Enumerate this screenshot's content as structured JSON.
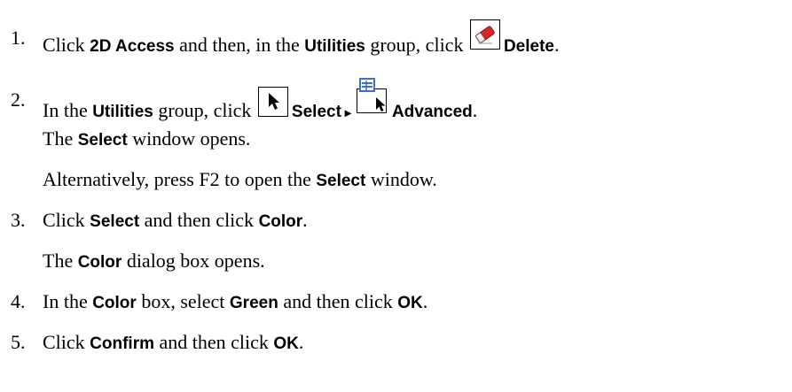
{
  "steps": [
    {
      "number": "1.",
      "text_a": "Click ",
      "ui_a": "2D Access",
      "text_b": " and then, in the ",
      "ui_b": "Utilities",
      "text_c": " group, click ",
      "ui_c": "Delete",
      "text_end": "."
    },
    {
      "number": "2.",
      "text_a": "In the ",
      "ui_a": "Utilities",
      "text_b": " group, click ",
      "ui_b": "Select",
      "arrow": "▸",
      "ui_c": "Advanced",
      "text_end": ".",
      "para1_ui": "Select",
      "para1_text": " window opens.",
      "para1_prefix": "The ",
      "para2_prefix": "Alternatively, press F2 to open the ",
      "para2_ui": "Select",
      "para2_text": " window."
    },
    {
      "number": "3.",
      "text_a": "Click ",
      "ui_a": "Select",
      "text_b": " and then click ",
      "ui_b": "Color",
      "text_end": ".",
      "para_prefix": "The ",
      "para_ui": "Color",
      "para_text": " dialog box opens."
    },
    {
      "number": "4.",
      "text_a": "In the ",
      "ui_a": "Color",
      "text_b": " box, select ",
      "ui_b": "Green",
      "text_c": " and then click ",
      "ui_c": "OK",
      "text_end": "."
    },
    {
      "number": "5.",
      "text_a": "Click ",
      "ui_a": "Confirm",
      "text_b": " and then click ",
      "ui_b": "OK",
      "text_end": "."
    }
  ],
  "icons": {
    "delete": "delete-eraser-icon",
    "select": "select-arrow-icon",
    "advanced": "advanced-select-icon"
  },
  "colors": {
    "eraser_red": "#d9262a",
    "advanced_blue": "#3b6fd4"
  }
}
